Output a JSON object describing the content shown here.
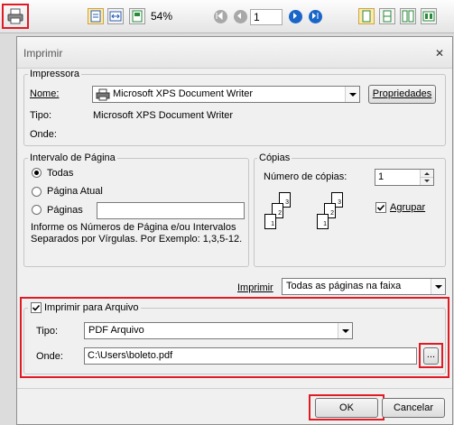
{
  "toolbar": {
    "zoom": "54%",
    "page_number": "1",
    "icons": [
      "print-icon",
      "page-view-icon",
      "page-fit-icon",
      "page-width-icon",
      "first-page-icon",
      "prev-page-icon",
      "next-page-icon",
      "last-page-icon",
      "single-page-icon",
      "two-page-icon",
      "multi-page-icon",
      "fit-screen-icon"
    ]
  },
  "dialog": {
    "title": "Imprimir",
    "close_label": "✕",
    "printer": {
      "legend": "Impressora",
      "name_label": "Nome:",
      "name_value": "Microsoft XPS Document Writer",
      "properties_button": "Propriedades",
      "type_label": "Tipo:",
      "type_value": "Microsoft XPS Document Writer",
      "where_label": "Onde:"
    },
    "page_range": {
      "legend": "Intervalo de Página",
      "all": "Todas",
      "current": "Página Atual",
      "pages": "Páginas",
      "hint": "Informe os Números de Página e/ou Intervalos Separados por Vírgulas. Por Exemplo: 1,3,5-12.",
      "selected": "all"
    },
    "copies": {
      "legend": "Cópias",
      "count_label": "Número de cópias:",
      "count_value": "1",
      "collate_label": "Agrupar",
      "collate_checked": true
    },
    "print_scope": {
      "label": "Imprimir",
      "value": "Todas as páginas na faixa"
    },
    "print_to_file": {
      "legend": "Imprimir para Arquivo",
      "checked": true,
      "type_label": "Tipo:",
      "type_value": "PDF Arquivo",
      "where_label": "Onde:",
      "path_value": "C:\\Users\\boleto.pdf",
      "browse_label": "..."
    },
    "ok_button": "OK",
    "cancel_button": "Cancelar"
  },
  "colors": {
    "highlight": "#e01b24",
    "nav_blue": "#1a66c8",
    "nav_gray": "#9a9a9a",
    "dialog_bg": "#f0f0f0"
  }
}
